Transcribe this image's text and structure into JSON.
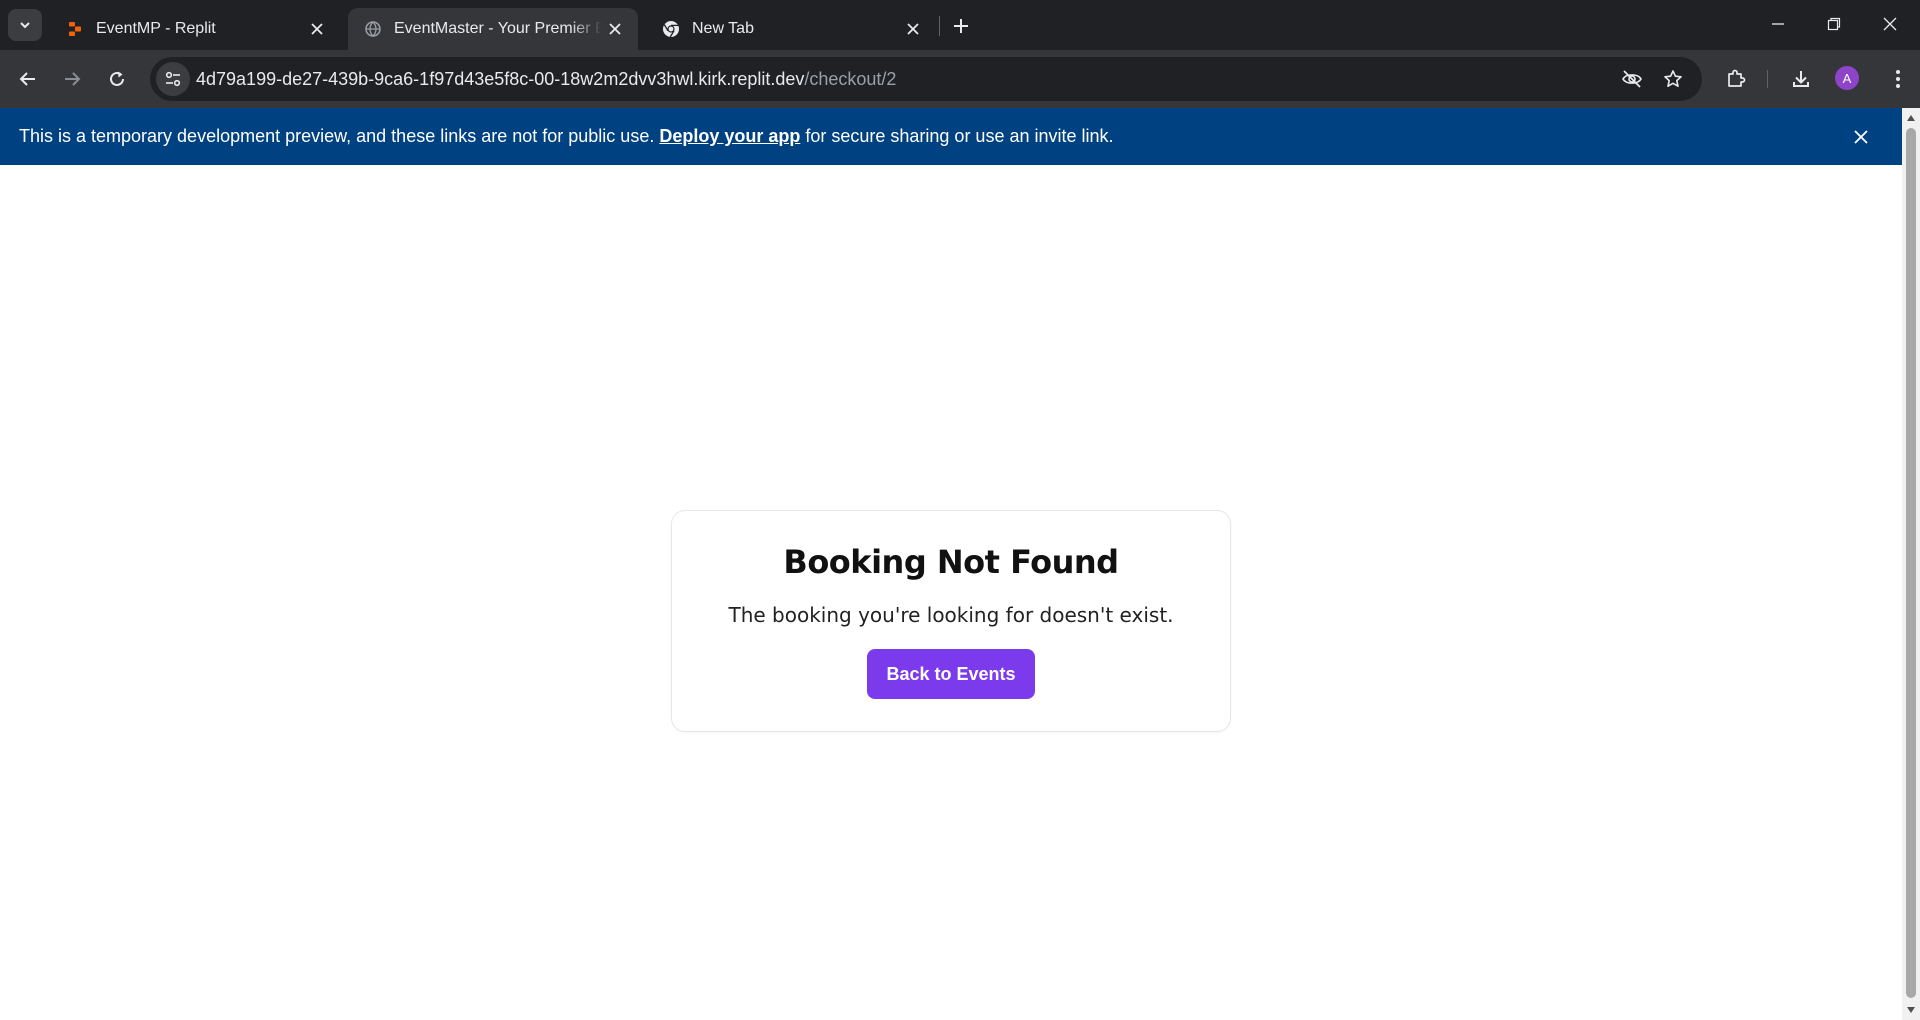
{
  "browser": {
    "tabs": [
      {
        "title": "EventMP - Replit",
        "favicon": "replit-icon",
        "active": false
      },
      {
        "title": "EventMaster - Your Premier Eve",
        "favicon": "globe-icon",
        "active": true
      },
      {
        "title": "New Tab",
        "favicon": "chrome-icon",
        "active": false
      }
    ],
    "url": {
      "host": "4d79a199-de27-439b-9ca6-1f97d43e5f8c-00-18w2m2dvv3hwl.kirk.replit.dev",
      "path": "/checkout/2"
    },
    "profile_initial": "A"
  },
  "banner": {
    "text_before": "This is a temporary development preview, and these links are not for public use.",
    "link": "Deploy your app",
    "text_after": "for secure sharing or use an invite link."
  },
  "card": {
    "title": "Booking Not Found",
    "message": "The booking you're looking for doesn't exist.",
    "button": "Back to Events"
  },
  "colors": {
    "accent": "#7c3aed",
    "banner": "#004182",
    "chrome_dark": "#202124",
    "chrome_toolbar": "#35363a"
  }
}
